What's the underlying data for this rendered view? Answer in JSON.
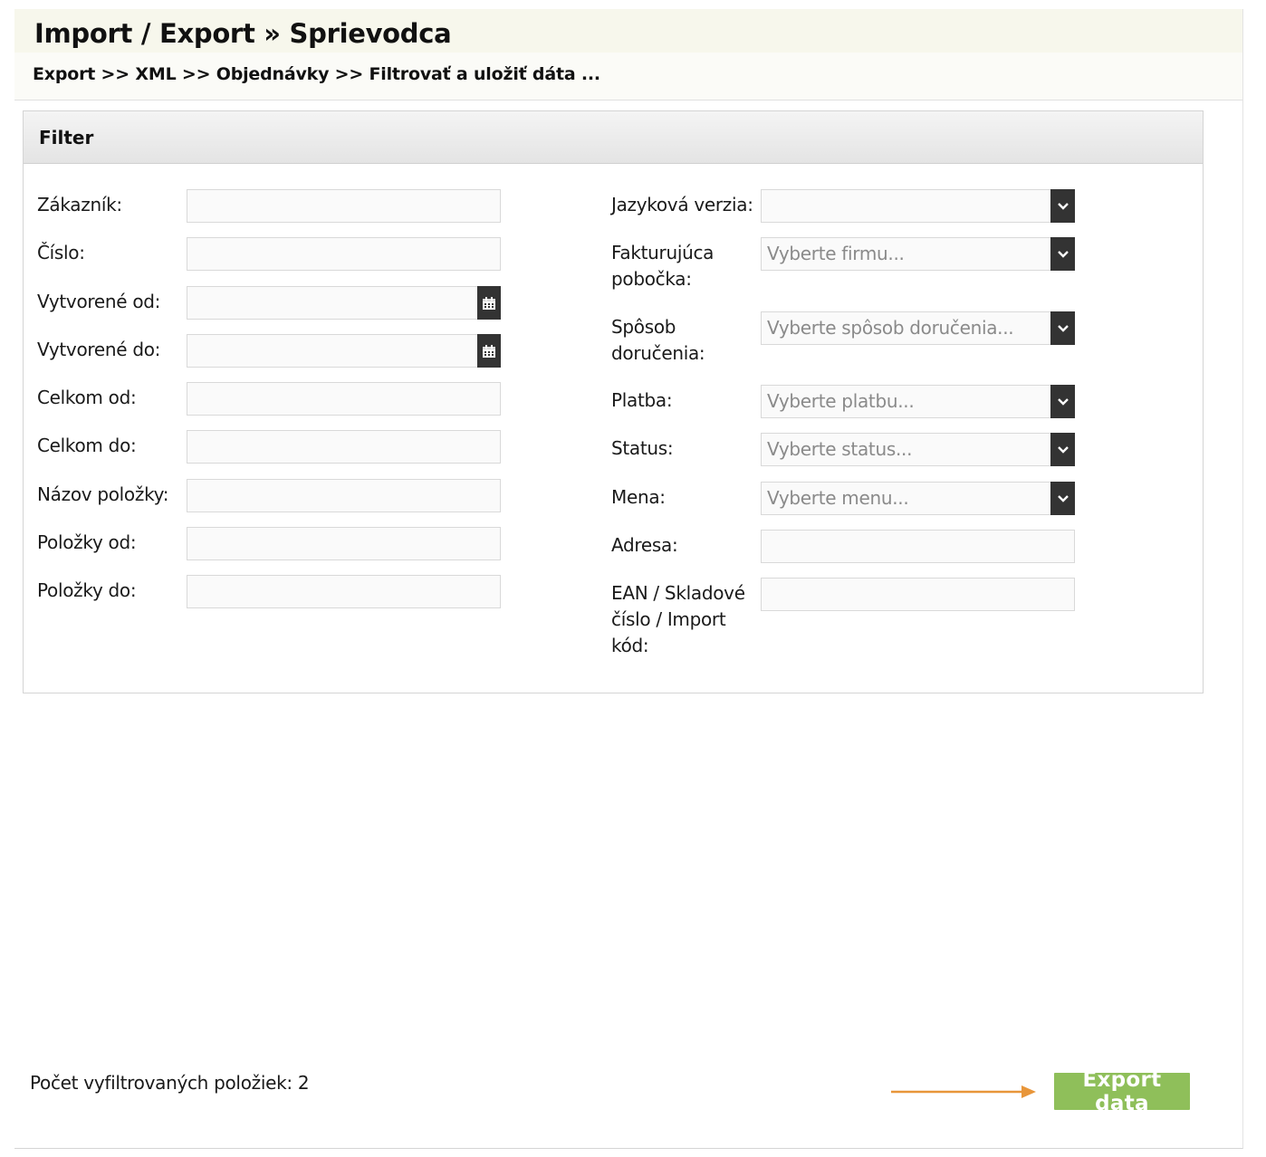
{
  "header": {
    "title": "Import / Export » Sprievodca",
    "breadcrumb": "Export >> XML >> Objednávky >> Filtrovať a uložiť dáta ..."
  },
  "filter": {
    "title": "Filter",
    "left_fields": [
      {
        "label": "Zákazník:",
        "value": "",
        "type": "text"
      },
      {
        "label": "Číslo:",
        "value": "",
        "type": "text"
      },
      {
        "label": "Vytvorené od:",
        "value": "",
        "type": "date",
        "icon": "calendar-icon"
      },
      {
        "label": "Vytvorené do:",
        "value": "",
        "type": "date",
        "icon": "calendar-icon"
      },
      {
        "label": "Celkom od:",
        "value": "",
        "type": "text"
      },
      {
        "label": "Celkom do:",
        "value": "",
        "type": "text"
      },
      {
        "label": "Názov položky:",
        "value": "",
        "type": "text"
      },
      {
        "label": "Položky od:",
        "value": "",
        "type": "text"
      },
      {
        "label": "Položky do:",
        "value": "",
        "type": "text"
      }
    ],
    "right_fields": [
      {
        "label": "Jazyková verzia:",
        "placeholder": "",
        "type": "select",
        "icon": "chevron-down-icon"
      },
      {
        "label_lines": [
          "Fakturujúca",
          "pobočka:"
        ],
        "placeholder": "Vyberte firmu...",
        "type": "select",
        "icon": "chevron-down-icon"
      },
      {
        "label_lines": [
          "Spôsob",
          "doručenia:"
        ],
        "placeholder": "Vyberte spôsob doručenia...",
        "type": "select",
        "icon": "chevron-down-icon"
      },
      {
        "label": "Platba:",
        "placeholder": "Vyberte platbu...",
        "type": "select",
        "icon": "chevron-down-icon"
      },
      {
        "label": "Status:",
        "placeholder": "Vyberte status...",
        "type": "select",
        "icon": "chevron-down-icon"
      },
      {
        "label": "Mena:",
        "placeholder": "Vyberte menu...",
        "type": "select",
        "icon": "chevron-down-icon"
      },
      {
        "label": "Adresa:",
        "value": "",
        "type": "text"
      },
      {
        "label_lines": [
          "EAN / Skladové",
          "číslo / Import",
          "kód:"
        ],
        "value": "",
        "type": "text"
      }
    ]
  },
  "footer": {
    "count_text": "Počet vyfiltrovaných položiek: 2",
    "export_label": "Export data",
    "pointer_icon": "arrow-right-icon"
  },
  "colors": {
    "accent_green": "#8fbf5a",
    "arrow_orange": "#e8963a",
    "dark_button": "#333333",
    "header_bg": "#f7f7ec"
  }
}
